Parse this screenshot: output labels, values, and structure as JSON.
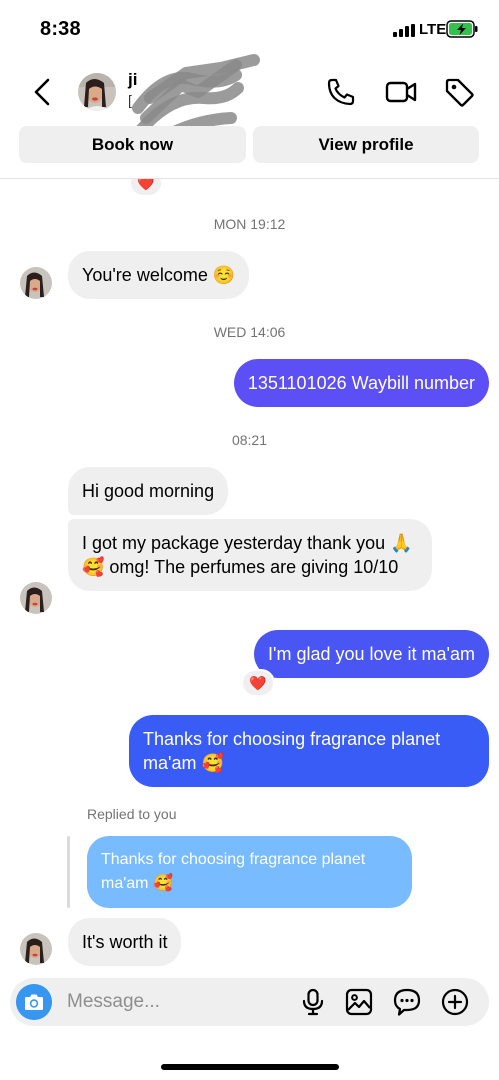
{
  "status_bar": {
    "time": "8:38",
    "network": "LTE"
  },
  "header": {
    "contact_name": "ji",
    "contact_handle": "[",
    "icons": [
      "back-icon",
      "phone-icon",
      "video-camera-icon",
      "tag-icon"
    ],
    "book_now_label": "Book now",
    "view_profile_label": "View profile"
  },
  "chat": {
    "timestamps": [
      "MON 19:12",
      "WED 14:06",
      "08:21"
    ],
    "messages": [
      {
        "from": "them",
        "text": "You're welcome ☺️"
      },
      {
        "from": "me",
        "text": "1351101026 Waybill number"
      },
      {
        "from": "them",
        "text": "Hi good morning"
      },
      {
        "from": "them",
        "text": "I got my package yesterday thank you 🙏 🥰 omg! The perfumes are giving 10/10"
      },
      {
        "from": "me",
        "text": "I'm glad you love it ma'am",
        "reaction": "❤️"
      },
      {
        "from": "me",
        "text": "Thanks for choosing fragrance planet ma'am 🥰"
      },
      {
        "from": "them",
        "text": "It's worth it"
      }
    ],
    "top_reaction": "❤️",
    "replied_label": "Replied to you",
    "replied_quote": "Thanks for choosing fragrance planet ma'am 🥰"
  },
  "composer": {
    "placeholder": "Message...",
    "icons": [
      "camera-icon",
      "microphone-icon",
      "gallery-icon",
      "sticker-icon",
      "plus-icon"
    ]
  },
  "colors": {
    "outgoing_purple": "#5b4ff5",
    "outgoing_blue": "#3a5cf6",
    "reply_quote": "#78bbff",
    "incoming": "#efefef",
    "camera": "#3797f0"
  }
}
